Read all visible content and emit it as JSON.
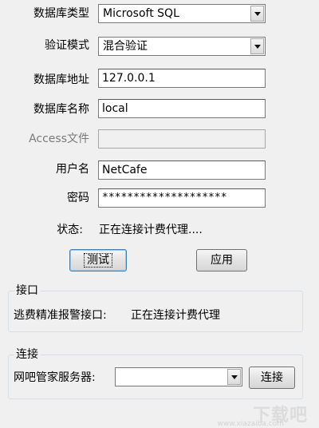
{
  "form": {
    "db_type": {
      "label": "数据库类型",
      "value": "Microsoft SQL"
    },
    "auth_mode": {
      "label": "验证模式",
      "value": "混合验证"
    },
    "db_address": {
      "label": "数据库地址",
      "value": "127.0.0.1"
    },
    "db_name": {
      "label": "数据库名称",
      "value": "local"
    },
    "access_file": {
      "label": "Access文件",
      "value": ""
    },
    "username": {
      "label": "用户名",
      "value": "NetCafe"
    },
    "password": {
      "label": "密码",
      "value": "********************"
    },
    "status": {
      "label": "状态:",
      "value": "正在连接计费代理...."
    },
    "test_button": "测试",
    "apply_button": "应用"
  },
  "interface_group": {
    "title": "接口",
    "label": "逃费精准报警接口:",
    "value": "正在连接计费代理"
  },
  "connect_group": {
    "title": "连接",
    "label": "网吧管家服务器:",
    "server_value": "",
    "connect_button": "连接"
  },
  "watermark": {
    "text": "下载吧",
    "sub": "www.xiazaiba.com"
  },
  "colors": {
    "background": "#f0f0f0",
    "focus_border": "#3c7fb1",
    "group_border": "#d5dfe5"
  },
  "icons": {
    "dropdown": "chevron-down-icon"
  }
}
